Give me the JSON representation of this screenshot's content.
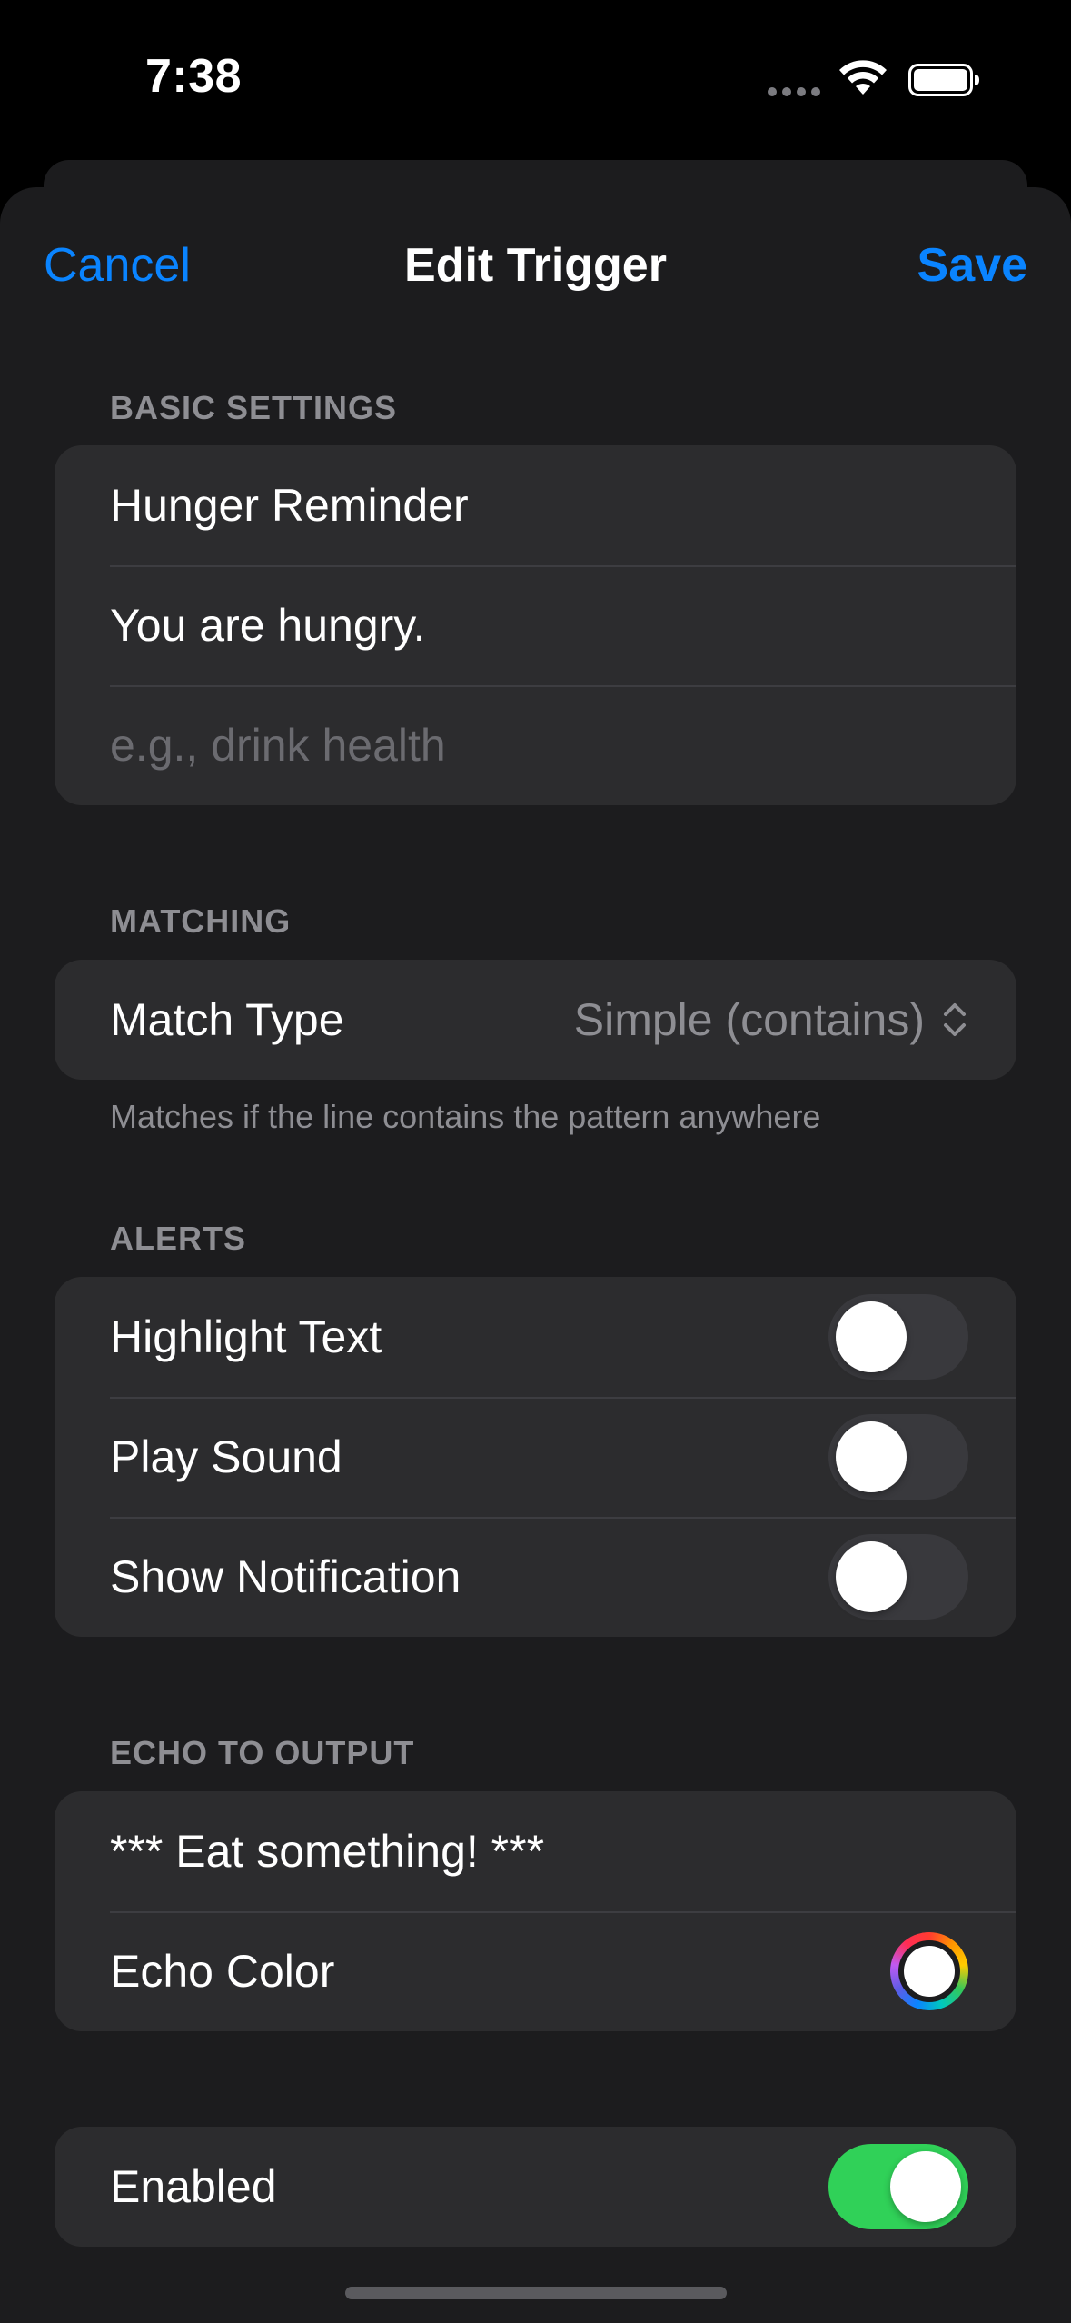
{
  "status_bar": {
    "time": "7:38",
    "wifi_icon": "wifi-icon",
    "battery_icon": "battery-icon"
  },
  "nav": {
    "cancel_label": "Cancel",
    "title": "Edit Trigger",
    "save_label": "Save"
  },
  "basic_settings": {
    "header": "BASIC SETTINGS",
    "name_value": "Hunger Reminder",
    "pattern_value": "You are hungry.",
    "command_placeholder": "e.g., drink health"
  },
  "matching": {
    "header": "MATCHING",
    "match_type_label": "Match Type",
    "match_type_value": "Simple (contains)",
    "footer": "Matches if the line contains the pattern anywhere"
  },
  "alerts": {
    "header": "ALERTS",
    "items": [
      {
        "label": "Highlight Text",
        "on": false
      },
      {
        "label": "Play Sound",
        "on": false
      },
      {
        "label": "Show Notification",
        "on": false
      }
    ]
  },
  "echo": {
    "header": "ECHO TO OUTPUT",
    "text_value": "*** Eat something! ***",
    "color_label": "Echo Color",
    "color_value": "#ffffff"
  },
  "enabled": {
    "label": "Enabled",
    "on": true
  },
  "colors": {
    "accent": "#0a84ff",
    "toggle_on": "#30d158",
    "toggle_off": "#39393d"
  }
}
